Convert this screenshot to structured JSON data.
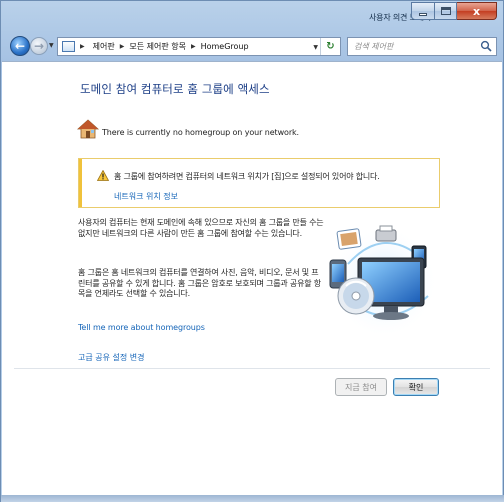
{
  "titlebar": {
    "feedback_link": "사용자 의견 보내기",
    "close_glyph": "x"
  },
  "navigation": {
    "breadcrumbs": [
      "제어판",
      "모든 제어판 항목",
      "HomeGroup"
    ],
    "refresh_glyph": "↻",
    "search_placeholder": "검색 제어판"
  },
  "main": {
    "heading": "도메인 참여 컴퓨터로 홈 그룹에 액세스",
    "status_text": "There is currently no homegroup on your network.",
    "warning": {
      "text": "홈 그룹에 참여하려면 컴퓨터의 네트워크 위치가 [집]으로 설정되어 있어야 합니다.",
      "link": "네트워크 위치 정보"
    },
    "paragraph1": "사용자의 컴퓨터는 현재 도메인에 속해 있으므로 자신의 홈 그룹을 만들 수는 없지만 네트워크의 다른 사람이 만든 홈 그룹에 참여할 수는 있습니다.",
    "paragraph2": "홈 그룹은 홈 네트워크의 컴퓨터를 연결하여 사진, 음악, 비디오, 문서 및 프린터를 공유할 수 있게 합니다. 홈 그룹은 암호로 보호되며 그룹과 공유할 항목을 언제라도 선택할 수 있습니다.",
    "learn_more_link": "Tell me more about homegroups",
    "advanced_link": "고급 공유 설정 변경"
  },
  "buttons": {
    "join": "지금 참여",
    "ok": "확인"
  },
  "colors": {
    "heading": "#1d3f87",
    "link": "#1565b8",
    "warning_border": "#eacc6c",
    "warning_bar": "#f0c23b"
  }
}
